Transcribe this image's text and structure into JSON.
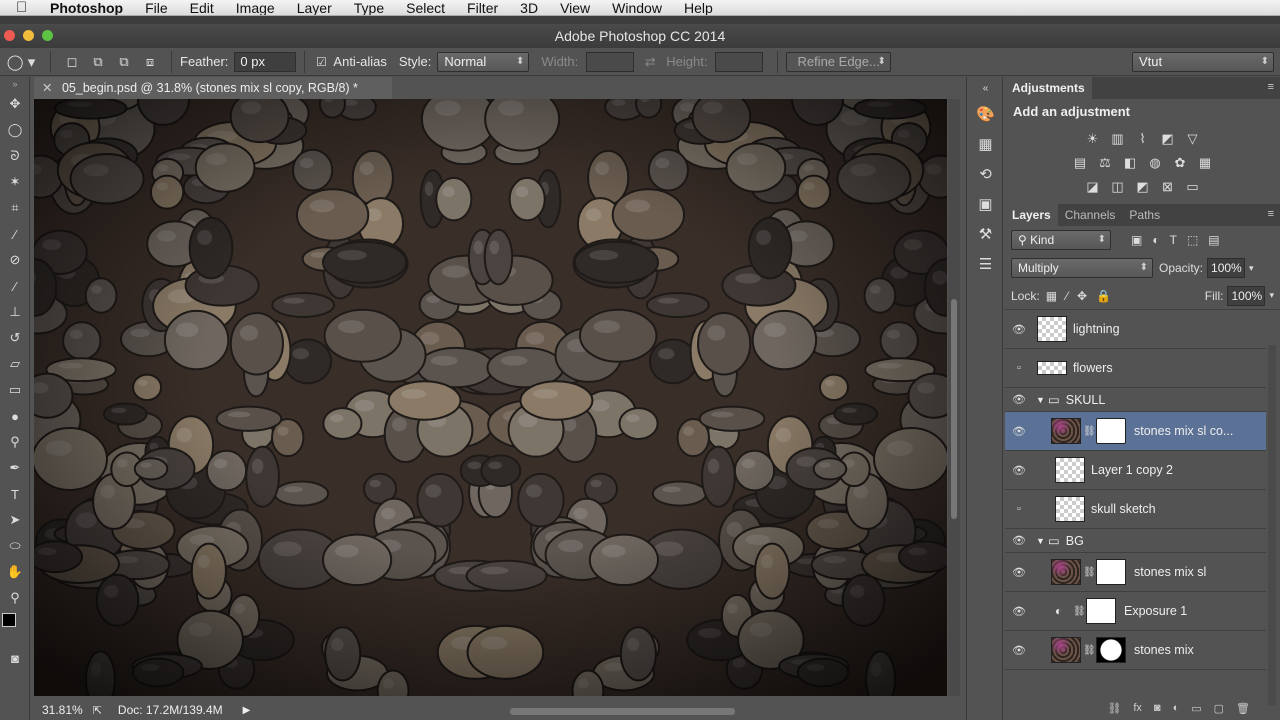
{
  "menubar": {
    "app": "Photoshop",
    "items": [
      "File",
      "Edit",
      "Image",
      "Layer",
      "Type",
      "Select",
      "Filter",
      "3D",
      "View",
      "Window",
      "Help"
    ]
  },
  "titlebar": {
    "title": "Adobe Photoshop CC 2014"
  },
  "options": {
    "feather_label": "Feather:",
    "feather_value": "0 px",
    "antialias_label": "Anti-alias",
    "style_label": "Style:",
    "style_value": "Normal",
    "width_label": "Width:",
    "height_label": "Height:",
    "refine_label": "Refine Edge...",
    "workspace": "Vtut"
  },
  "document": {
    "tab": "05_begin.psd @ 31.8% (stones mix sl copy, RGB/8) *"
  },
  "status": {
    "zoom": "31.81%",
    "doc": "Doc: 17.2M/139.4M"
  },
  "adjustments": {
    "tab": "Adjustments",
    "title": "Add an adjustment"
  },
  "layers_panel": {
    "tabs": [
      "Layers",
      "Channels",
      "Paths"
    ],
    "filter": "Kind",
    "blend": "Multiply",
    "opacity_label": "Opacity:",
    "opacity": "100%",
    "lock_label": "Lock:",
    "fill_label": "Fill:",
    "fill": "100%",
    "layers": [
      {
        "name": "lightning",
        "visible": true
      },
      {
        "name": "flowers",
        "visible": false
      },
      {
        "name": "SKULL",
        "group": true,
        "visible": true
      },
      {
        "name": "stones mix sl co...",
        "visible": true,
        "selected": true
      },
      {
        "name": "Layer 1 copy 2",
        "visible": true
      },
      {
        "name": "skull sketch",
        "visible": false
      },
      {
        "name": "BG",
        "group": true,
        "visible": true
      },
      {
        "name": "stones mix sl",
        "visible": true
      },
      {
        "name": "Exposure 1",
        "visible": true
      },
      {
        "name": "stones mix",
        "visible": true
      }
    ]
  }
}
